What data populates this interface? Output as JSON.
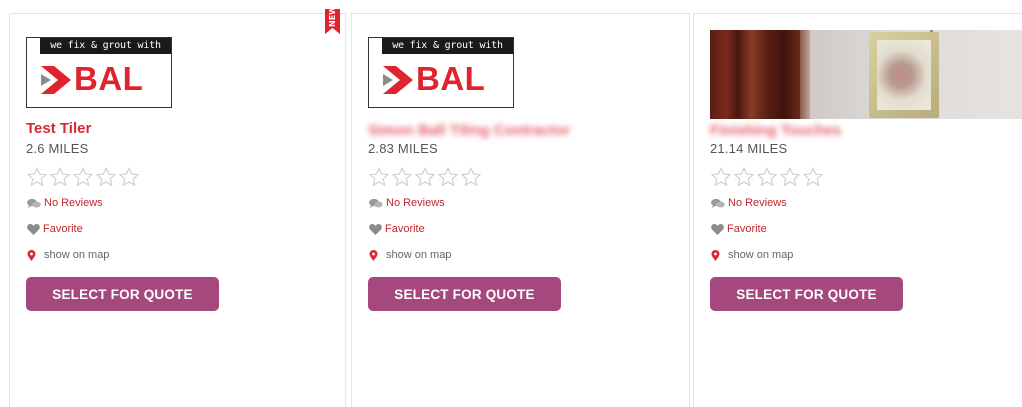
{
  "colors": {
    "accent_red": "#d42a37",
    "button_purple": "#a5487e",
    "ribbon_red": "#e0242f"
  },
  "cards": [
    {
      "badge": "NEW",
      "logo": {
        "tagline": "we fix & grout with",
        "brand": "BAL"
      },
      "name": "Test Tiler",
      "distance": "2.6 MILES",
      "rating": 0,
      "reviews_label": "No Reviews",
      "favorite_label": "Favorite",
      "map_label": "show on map",
      "quote_button": "SELECT FOR QUOTE"
    },
    {
      "logo": {
        "tagline": "we fix & grout with",
        "brand": "BAL"
      },
      "name": "Simon Ball Tiling Contractor",
      "distance": "2.83 MILES",
      "rating": 0,
      "reviews_label": "No Reviews",
      "favorite_label": "Favorite",
      "map_label": "show on map",
      "quote_button": "SELECT FOR QUOTE"
    },
    {
      "name": "Finishing Touches",
      "distance": "21.14 MILES",
      "rating": 0,
      "reviews_label": "No Reviews",
      "favorite_label": "Favorite",
      "map_label": "show on map",
      "quote_button": "SELECT FOR QUOTE"
    }
  ],
  "icons": {
    "star": "star-outline-icon",
    "reviews": "speech-bubbles-icon",
    "favorite": "heart-icon",
    "map": "map-pin-icon",
    "badge": "ribbon-bookmark-icon"
  }
}
